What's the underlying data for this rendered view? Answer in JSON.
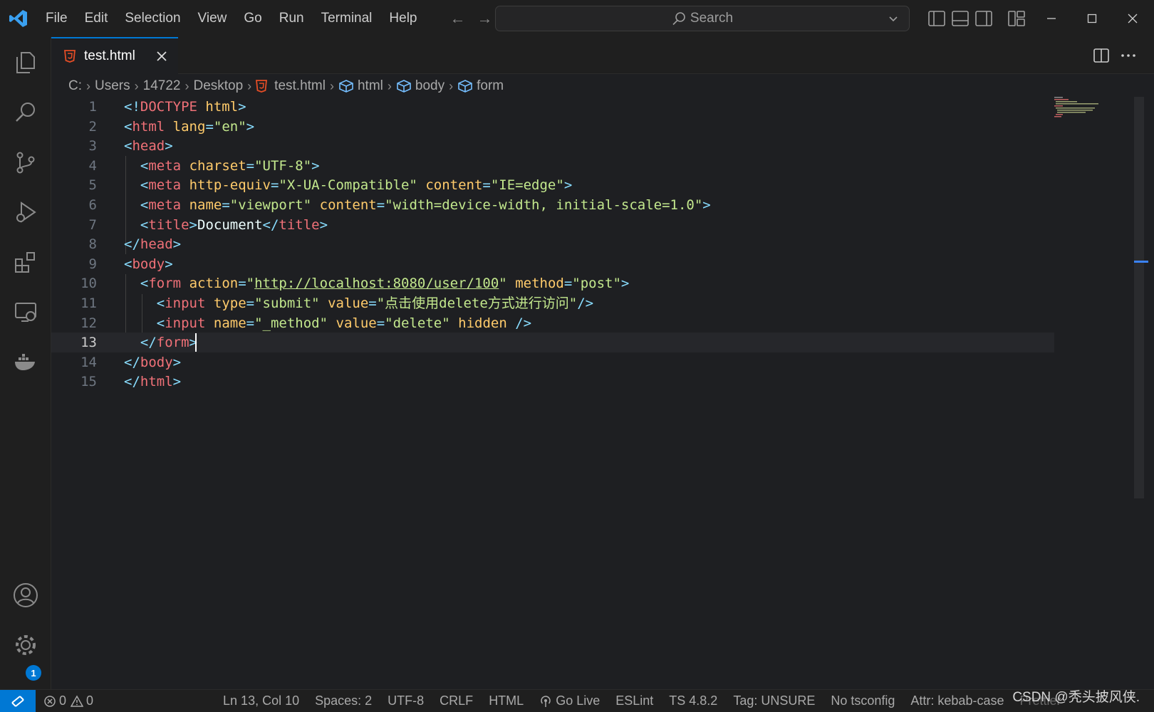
{
  "titlebar": {
    "menu": [
      "File",
      "Edit",
      "Selection",
      "View",
      "Go",
      "Run",
      "Terminal",
      "Help"
    ],
    "search_placeholder": "Search"
  },
  "tabs": [
    {
      "label": "test.html"
    }
  ],
  "breadcrumb": [
    "C:",
    "Users",
    "14722",
    "Desktop",
    "test.html",
    "html",
    "body",
    "form"
  ],
  "editor": {
    "current_line": 13,
    "lines": [
      "1",
      "2",
      "3",
      "4",
      "5",
      "6",
      "7",
      "8",
      "9",
      "10",
      "11",
      "12",
      "13",
      "14",
      "15"
    ],
    "code": {
      "l1": {
        "a": "<!",
        "b": "DOCTYPE",
        "c": " html",
        "d": ">"
      },
      "l2": {
        "tag": "html",
        "attr": "lang",
        "val": "\"en\""
      },
      "l3": {
        "tag": "head"
      },
      "l4": {
        "tag": "meta",
        "attr": "charset",
        "val": "\"UTF-8\""
      },
      "l5": {
        "tag": "meta",
        "attr1": "http-equiv",
        "val1": "\"X-UA-Compatible\"",
        "attr2": "content",
        "val2": "\"IE=edge\""
      },
      "l6": {
        "tag": "meta",
        "attr1": "name",
        "val1": "\"viewport\"",
        "attr2": "content",
        "val2": "\"width=device-width, initial-scale=1.0\""
      },
      "l7": {
        "tag": "title",
        "text": "Document"
      },
      "l8": {
        "tag": "head"
      },
      "l9": {
        "tag": "body"
      },
      "l10": {
        "tag": "form",
        "attr1": "action",
        "url": "http://localhost:8080/user/100",
        "attr2": "method",
        "val2": "\"post\""
      },
      "l11": {
        "tag": "input",
        "attr1": "type",
        "val1": "\"submit\"",
        "attr2": "value",
        "val2": "\"点击使用delete方式进行访问\""
      },
      "l12": {
        "tag": "input",
        "attr1": "name",
        "val1": "\"_method\"",
        "attr2": "value",
        "val2": "\"delete\"",
        "attr3": "hidden"
      },
      "l13": {
        "tag": "form"
      },
      "l14": {
        "tag": "body"
      },
      "l15": {
        "tag": "html"
      }
    }
  },
  "activity_badge": "1",
  "statusbar": {
    "errors": "0",
    "warnings": "0",
    "position": "Ln 13, Col 10",
    "spaces": "Spaces: 2",
    "encoding": "UTF-8",
    "eol": "CRLF",
    "language": "HTML",
    "golive": "Go Live",
    "eslint": "ESLint",
    "ts": "TS 4.8.2",
    "tag": "Tag: UNSURE",
    "tsconfig": "No tsconfig",
    "attr": "Attr: kebab-case",
    "prettier": "Prettier",
    "watermark": "CSDN @秃头披风侠."
  },
  "colors": {
    "accent": "#0078d4",
    "html_icon": "#e44d26",
    "tag": "#f07178",
    "attr": "#ffcb6b",
    "string": "#c3e88d"
  }
}
